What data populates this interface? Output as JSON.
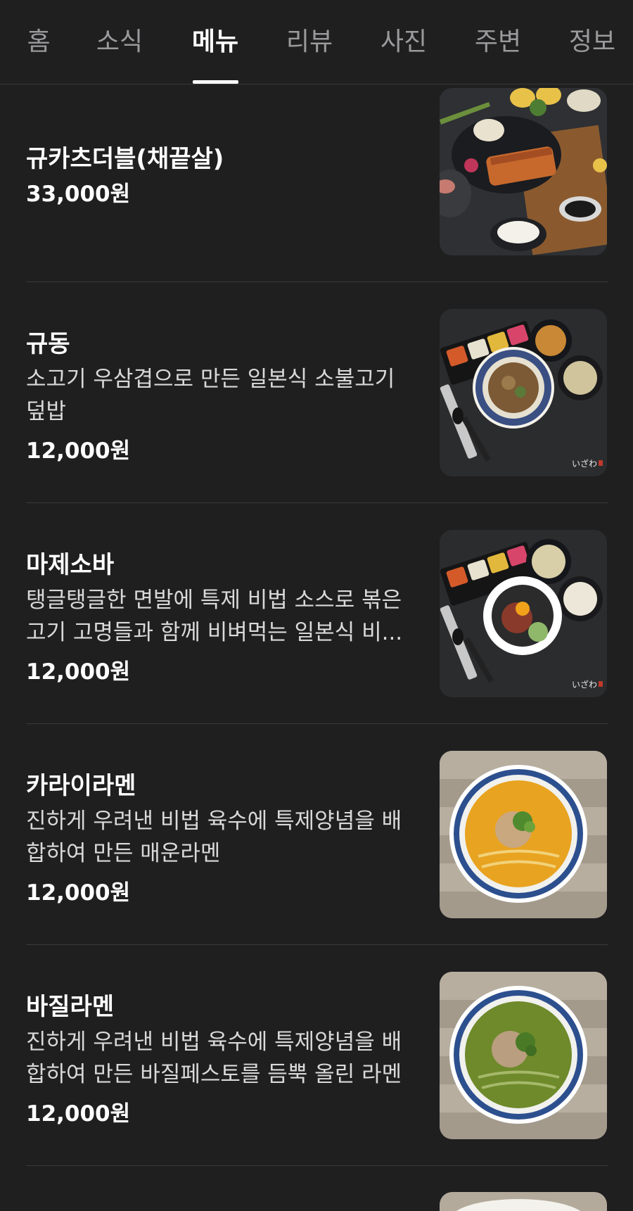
{
  "tabs": [
    {
      "label": "홈"
    },
    {
      "label": "소식"
    },
    {
      "label": "메뉴",
      "active": true
    },
    {
      "label": "리뷰"
    },
    {
      "label": "사진"
    },
    {
      "label": "주변"
    },
    {
      "label": "정보"
    }
  ],
  "menu": [
    {
      "name": "규카츠더블(채끝살)",
      "description": "",
      "price": "33,000원",
      "image_icon": "gyukatsu-photo"
    },
    {
      "name": "규동",
      "description": "소고기 우삼겹으로 만든 일본식 소불고기 덮밥",
      "price": "12,000원",
      "image_icon": "gyudon-photo",
      "image_caption": "いざわ"
    },
    {
      "name": "마제소바",
      "description": "탱글탱글한 면발에 특제 비법 소스로 볶은 고기 고명들과 함께 비벼먹는 일본식 비...",
      "price": "12,000원",
      "image_icon": "mazesoba-photo",
      "image_caption": "いざわ"
    },
    {
      "name": "카라이라멘",
      "description": "진하게 우려낸 비법 육수에 특제양념을 배합하여 만든 매운라멘",
      "price": "12,000원",
      "image_icon": "karai-ramen-photo"
    },
    {
      "name": "바질라멘",
      "description": "진하게 우려낸 비법 육수에 특제양념을 배합하여 만든 바질페스토를 듬뿍 올린 라멘",
      "price": "12,000원",
      "image_icon": "basil-ramen-photo"
    }
  ]
}
